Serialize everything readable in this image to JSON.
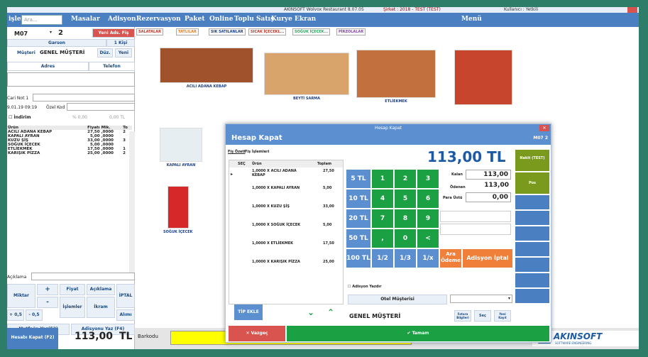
{
  "window": {
    "title": "AKINSOFT Wolvox Restaurant 8.07.05",
    "period": "Şirket : 2018 - TEST (TEST)",
    "user": "Kullanıcı : Yetkili"
  },
  "topnav": {
    "left_partial": "işler",
    "search_placeholder": "Ara...",
    "items": [
      "Masalar",
      "Adisyon",
      "Rezervasyon",
      "Paket",
      "Online",
      "Toplu Satış",
      "Kurye Ekran"
    ],
    "menu_label": "Menü"
  },
  "categories": [
    "SALATALAR",
    "TATLILAR",
    "SIK SATILANLAR",
    "SICAK İÇECEKL...",
    "SOĞUK İÇECEK...",
    "PİRZOLALAR"
  ],
  "left": {
    "table_code": "M07",
    "guest_count": "2",
    "new_order_btn": "Yeni Ads. Fiş",
    "waiter_label": "Garson",
    "persons_label": "1 Kişi",
    "customer_label": "Müşteri",
    "customer_name": "GENEL MÜŞTERİ",
    "edit_btn": "Düz.",
    "new_btn": "Yeni",
    "address_label": "Adres",
    "phone_label": "Telefon",
    "note_label": "Cari Not 1",
    "date": "9.01.19 09:19",
    "special_code_label": "Özel Kod",
    "discount_label": "İndirim",
    "discount_pct": "% 0,00",
    "discount_amt": "0,00 TL",
    "cols": [
      "Ürün",
      "Fiyatı",
      "Mik.",
      "To"
    ],
    "rows": [
      [
        "ACILI ADANA KEBAP",
        "27,50",
        ",0000",
        "2"
      ],
      [
        "KAPALI AYRAN",
        "5,00",
        ",0000",
        ""
      ],
      [
        "KUZU ŞİŞ",
        "33,00",
        ",0000",
        "3"
      ],
      [
        "SOĞUK İÇECEK",
        "5,00",
        ",0000",
        ""
      ],
      [
        "ETLİEKMEK",
        "17,50",
        ",0000",
        "1"
      ],
      [
        "KARIŞIK PİZZA",
        "25,00",
        ",0000",
        "2"
      ]
    ],
    "description_label": "Açıklama",
    "qty_label": "Miktar",
    "plus": "+",
    "minus": "-",
    "price_btn": "Fiyat",
    "desc_btn": "Açıklama",
    "cancel_btn": "İPTAL",
    "plus_half": "+ 0,5",
    "minus_half": "- 0,5",
    "ops_btn": "İşlemler",
    "treat_btn": "İkram",
    "account_btn": "Alımı",
    "kitchen_print_btn": "Mutfağa Yaz(F3)",
    "bill_print_btn": "Adisyonu Yaz (F4)",
    "pay_btn": "Hesabı Kapat (F2)",
    "total": "113,00",
    "currency": "TL",
    "barcode_label": "Barkodu"
  },
  "products": [
    {
      "name": "ACILI ADANA KEBAP",
      "color": "#a0522d"
    },
    {
      "name": "BEYTİ SARMA",
      "color": "#d9a46b"
    },
    {
      "name": "ETLİEKMEK",
      "color": "#c2703d"
    },
    {
      "name": "",
      "color": "#c8452d"
    },
    {
      "name": "KAPALI AYRAN",
      "color": "#e6eef2"
    },
    {
      "name": "SOĞUK İÇECEK",
      "color": "#d62828"
    }
  ],
  "dialog": {
    "titlebar": "Hesap Kapat",
    "title": "Hesap Kapat",
    "table_ref": "M07  2",
    "tab1": "Fiş Özeti",
    "tab2": "Fiş İşlemleri",
    "cols": [
      "SEÇ",
      "Ürün",
      "Toplam"
    ],
    "rows": [
      [
        "1,0000 X ACILI ADANA KEBAP",
        "27,50"
      ],
      [
        "1,0000 X KAPALI AYRAN",
        "5,00"
      ],
      [
        "1,0000 X KUZU ŞİŞ",
        "33,00"
      ],
      [
        "1,0000 X SOĞUK İÇECEK",
        "5,00"
      ],
      [
        "1,0000 X ETLİEKMEK",
        "17,50"
      ],
      [
        "1,0000 X KARIŞIK PİZZA",
        "25,00"
      ]
    ],
    "big_total": "113,00 TL",
    "quick": [
      "5 TL",
      "10 TL",
      "20 TL",
      "50 TL",
      "100 TL"
    ],
    "keys": [
      "1",
      "2",
      "3",
      "4",
      "5",
      "6",
      "7",
      "8",
      "9",
      ",",
      "0",
      "<"
    ],
    "frac": [
      "1/2",
      "1/3",
      "1/x"
    ],
    "subtotal_btn": "Ara Ödeme",
    "cancel_bill_btn": "Adisyon İptal",
    "remaining_label": "Kalan",
    "remaining": "113,00",
    "paid_label": "Ödenen",
    "paid": "113,00",
    "change_label": "Para Üstü",
    "change": "0,00",
    "print_bill_label": "Adisyon Yazdır",
    "hotel_btn": "Otel Müşterisi",
    "tip_btn": "TİP EKLE",
    "customer": "GENEL MÜŞTERİ",
    "invoice_btn": "Fatura Bilgileri",
    "select_btn": "Seç",
    "new_record_btn": "Yeni Kayıt",
    "cancel": "Vazgeç",
    "ok": "Tamam",
    "side_cash": "Nakit (TEST)",
    "side_pos": "Pos"
  },
  "brand": {
    "name": "AKINSOFT",
    "tag": "SOFTWARE ENGINEERING"
  }
}
